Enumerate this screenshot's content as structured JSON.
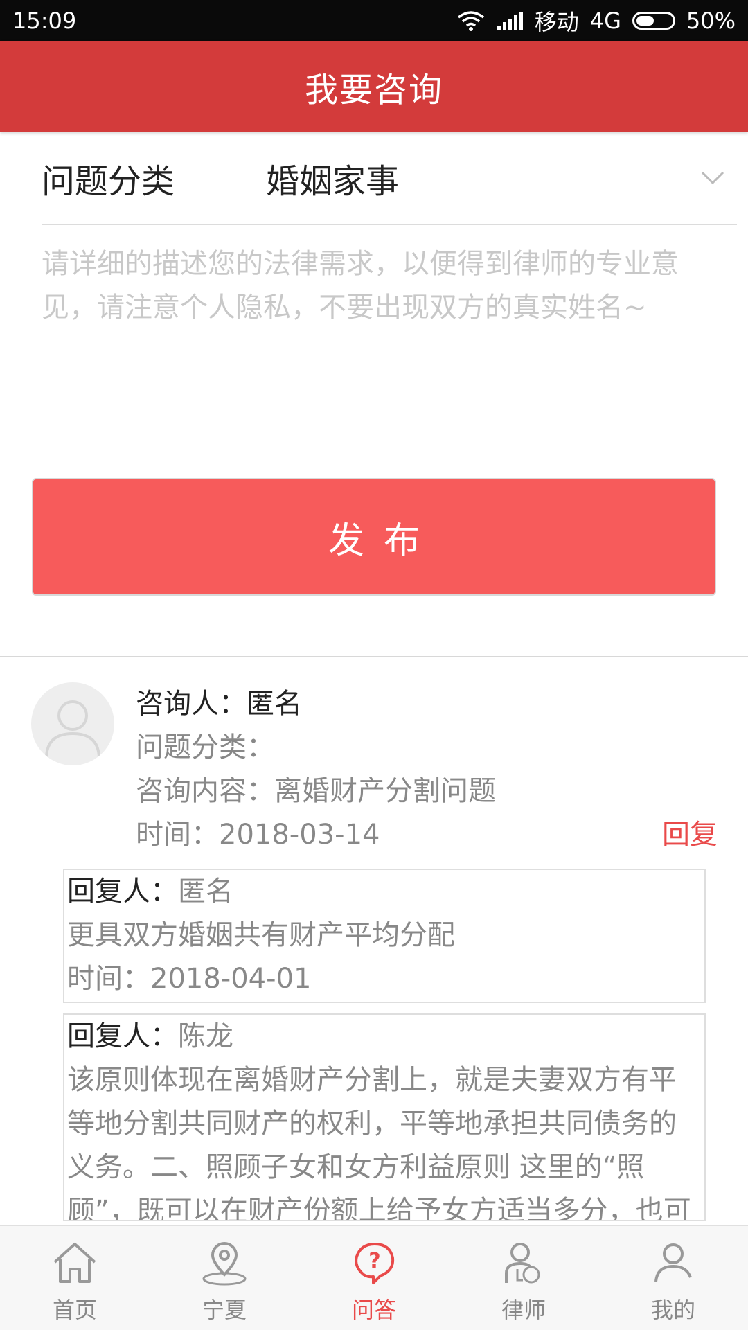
{
  "status_bar": {
    "time": "15:09",
    "carrier": "移动",
    "network": "4G",
    "battery": "50%",
    "battery_level": 0.5
  },
  "header": {
    "title": "我要咨询"
  },
  "form": {
    "category_label": "问题分类",
    "category_value": "婚姻家事",
    "description_placeholder": "请详细的描述您的法律需求，以便得到律师的专业意见，请注意个人隐私，不要出现双方的真实姓名~",
    "description_value": "",
    "publish_label": "发布"
  },
  "consult": {
    "asker_label": "咨询人：",
    "asker_name": "匿名",
    "category_label": "问题分类：",
    "category_value": "",
    "content_label": "咨询内容：",
    "content_value": "离婚财产分割问题",
    "time_label": "时间：",
    "time_value": "2018-03-14",
    "reply_link": "回复",
    "replies": [
      {
        "replier_label": "回复人：",
        "replier_name": "匿名",
        "content": "更具双方婚姻共有财产平均分配",
        "time_label": "时间：",
        "time_value": "2018-04-01"
      },
      {
        "replier_label": "回复人：",
        "replier_name": "陈龙",
        "content": "该原则体现在离婚财产分割上，就是夫妻双方有平等地分割共同财产的权利，平等地承担共同债务的义务。二、照顾子女和女方利益原则 这里的“照顾”，既可以在财产份额上给予女方适当多分，也可"
      }
    ]
  },
  "bottom_nav": {
    "items": [
      {
        "label": "首页",
        "icon": "home-icon"
      },
      {
        "label": "宁夏",
        "icon": "location-icon"
      },
      {
        "label": "问答",
        "icon": "qa-icon",
        "active": true
      },
      {
        "label": "律师",
        "icon": "lawyer-icon"
      },
      {
        "label": "我的",
        "icon": "user-icon"
      }
    ],
    "active_color": "#e94a4a"
  },
  "colors": {
    "header": "#d33b3b",
    "button": "#f75b5b",
    "accent": "#e94a4a"
  }
}
